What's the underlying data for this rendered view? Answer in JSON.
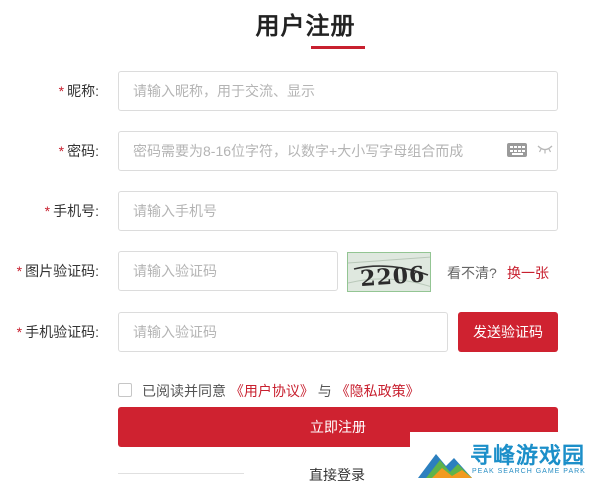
{
  "page": {
    "title": "用户注册"
  },
  "form": {
    "nickname": {
      "required_mark": "*",
      "label": "昵称:",
      "placeholder": "请输入昵称，用于交流、显示"
    },
    "password": {
      "required_mark": "*",
      "label": "密码:",
      "placeholder": "密码需要为8-16位字符，以数字+大小写字母组合而成"
    },
    "phone": {
      "required_mark": "*",
      "label": "手机号:",
      "placeholder": "请输入手机号"
    },
    "image_code": {
      "required_mark": "*",
      "label": "图片验证码:",
      "placeholder": "请输入验证码",
      "captcha_text": "2206",
      "unclear_text": "看不清?",
      "refresh_link": "换一张"
    },
    "sms_code": {
      "required_mark": "*",
      "label": "手机验证码:",
      "placeholder": "请输入验证码",
      "send_button": "发送验证码"
    }
  },
  "agreement": {
    "prefix": "已阅读并同意",
    "user_agreement": "《用户协议》",
    "and": "与",
    "privacy_policy": "《隐私政策》"
  },
  "submit_button": "立即注册",
  "login_link": "直接登录",
  "watermark": {
    "name": "寻峰游戏园",
    "subtitle": "PEAK SEARCH GAME PARK"
  },
  "colors": {
    "accent": "#cf2230",
    "border": "#dcdcdc",
    "placeholder": "#b4b4b4",
    "watermark": "#1c8fc9"
  }
}
